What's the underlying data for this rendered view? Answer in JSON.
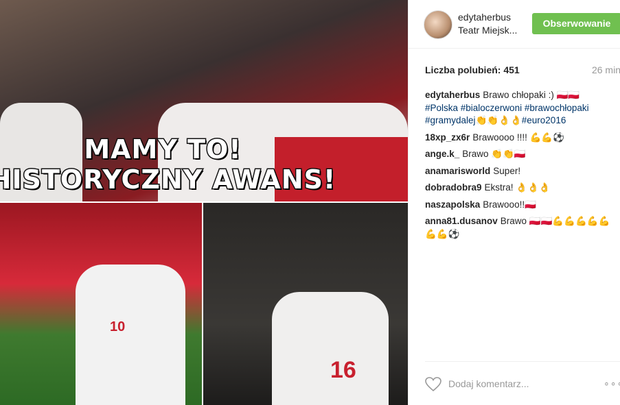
{
  "image": {
    "caption_line1": "MAMY TO!",
    "caption_line2": "HISTORYCZNY AWANS!",
    "number_left": "10",
    "number_right": "16"
  },
  "header": {
    "username": "edytaherbus",
    "location": "Teatr Miejsk...",
    "follow_label": "Obserwowanie"
  },
  "stats": {
    "likes_label": "Liczba polubień: 451",
    "time": "26 min"
  },
  "comments": [
    {
      "user": "edytaherbus",
      "text": "Brawo chłopaki :) 🇵🇱🇵🇱",
      "tags": "#Polska #bialoczerwoni #brawochłopaki #gramydalej👏👏👌👌#euro2016"
    },
    {
      "user": "18xp_zx6r",
      "text": "Brawoooo !!!! 💪💪⚽"
    },
    {
      "user": "ange.k_",
      "text": "Brawo 👏👏🇵🇱"
    },
    {
      "user": "anamarisworld",
      "text": "Super!"
    },
    {
      "user": "dobradobra9",
      "text": "Ekstra! 👌👌👌"
    },
    {
      "user": "naszapolska",
      "text": "Brawooo!!🇵🇱"
    },
    {
      "user": "anna81.dusanov",
      "text": "Brawo 🇵🇱🇵🇱💪💪💪💪💪💪💪⚽"
    }
  ],
  "footer": {
    "add_comment_placeholder": "Dodaj komentarz...",
    "more_label": "∘∘∘"
  }
}
